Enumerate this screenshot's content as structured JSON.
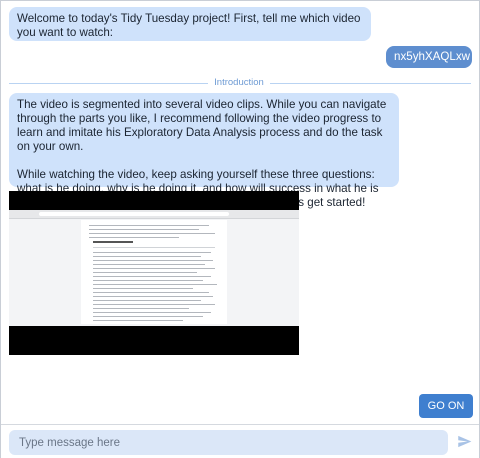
{
  "messages": {
    "bot_welcome": "Welcome to today's Tidy Tuesday project! First, tell me which video you want to watch:",
    "user_video_id": "nx5yhXAQLxw",
    "intro_paragraph_1": "The video is segmented into several video clips. While you can navigate through the parts you like, I recommend following the video progress to learn and imitate his Exploratory Data Analysis process and do the task on your own.",
    "intro_paragraph_2": "While watching the video, keep asking yourself these three questions: what is he doing, why is he doing it, and how will success in what he is doing help him find a solution to the problem ? Now let's get started!"
  },
  "divider": {
    "label": "Introduction"
  },
  "actions": {
    "go_on_label": "GO ON"
  },
  "composer": {
    "placeholder": "Type message here"
  },
  "icons": {
    "send": "send-paper-plane-icon"
  },
  "colors": {
    "bot_bubble": "#cfe2fb",
    "user_bubble": "#5e8ecf",
    "accent_button": "#3f7fcf",
    "divider": "#6e9bd4",
    "input_bg": "#dbe7f8"
  }
}
